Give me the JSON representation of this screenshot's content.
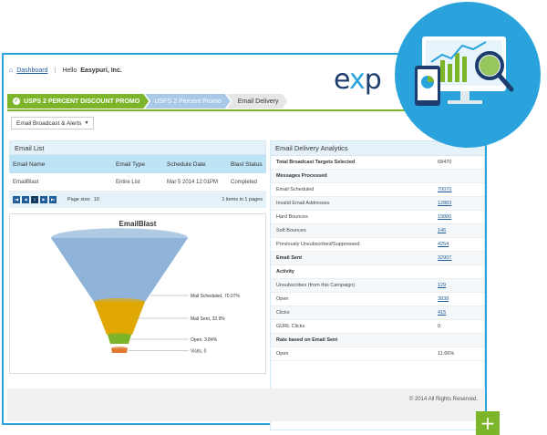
{
  "header": {
    "dashboard_link": "Dashboard",
    "hello_prefix": "Hello",
    "company": "Easypuri, Inc.",
    "logo_left": "e",
    "logo_x": "x",
    "logo_right": "p"
  },
  "breadcrumb": {
    "step1": "USPS 2 PERCENT DISCOUNT PROMO",
    "step2": "USPS 2 Percent Promo",
    "step3": "Email Delivery"
  },
  "menu": {
    "label": "Email Broadcast & Alerts"
  },
  "email_list": {
    "title": "Email List",
    "columns": [
      "Email Name",
      "Email Type",
      "Schedule Date",
      "Blast Status"
    ],
    "rows": [
      [
        "EmailBlast",
        "Entire List",
        "Mar 5 2014 12:01PM",
        "Completed"
      ]
    ],
    "pager": {
      "buttons": [
        "|◀",
        "◀",
        "1",
        "▶",
        "▶|"
      ],
      "page_size_label": "Page size:",
      "page_size": "10",
      "info": "1 items in 1 pages"
    }
  },
  "chart_data": {
    "type": "funnel",
    "title": "EmailBlast",
    "stages": [
      {
        "label": "Mail Scheduled",
        "percent": 70.07,
        "text": "Mail Scheduled, 70.07%"
      },
      {
        "label": "Mail Sent",
        "percent": 32.9,
        "text": "Mail Sent, 32.9%"
      },
      {
        "label": "Open",
        "percent": 3.84,
        "text": "Open, 3.84%"
      },
      {
        "label": "Visits",
        "percent": 0,
        "text": "Visits, 0"
      }
    ],
    "colors": [
      "#8fb3d9",
      "#e0a800",
      "#7cb52a",
      "#e07a30"
    ]
  },
  "analytics": {
    "title": "Email Delivery Analytics",
    "rows": [
      {
        "label": "Total Broadcast Targets Selected",
        "value": "68470",
        "bold": true,
        "link": false
      },
      {
        "label": "Messages Processed",
        "value": "",
        "bold": true,
        "link": false
      },
      {
        "label": "Email Scheduled",
        "value": "70070",
        "bold": false,
        "link": true
      },
      {
        "label": "Invalid Email Addresses",
        "value": "12883",
        "bold": false,
        "link": true
      },
      {
        "label": "Hard Bounces",
        "value": "19880",
        "bold": false,
        "link": true
      },
      {
        "label": "Soft Bounces",
        "value": "146",
        "bold": false,
        "link": true
      },
      {
        "label": "Previously Unsubscribed/Suppressed",
        "value": "4254",
        "bold": false,
        "link": true
      },
      {
        "label": "Email Sent",
        "value": "32907",
        "bold": true,
        "link": true
      },
      {
        "label": "Activity",
        "value": "",
        "bold": true,
        "link": false
      },
      {
        "label": "Unsubscribes (from this Campaign)",
        "value": "129",
        "bold": false,
        "link": true
      },
      {
        "label": "Open",
        "value": "3838",
        "bold": false,
        "link": true
      },
      {
        "label": "Clicks",
        "value": "415",
        "bold": false,
        "link": true
      },
      {
        "label": "GURL Clicks",
        "value": "0",
        "bold": false,
        "link": false
      },
      {
        "label": "Rate based on Email Sent",
        "value": "",
        "bold": true,
        "link": false
      },
      {
        "label": "Open",
        "value": "11.66%",
        "bold": false,
        "link": false
      }
    ]
  },
  "footer": {
    "copyright": "© 2014 All Rights Reserved."
  },
  "plus_label": "+",
  "colors": {
    "accent_blue": "#2aa3dc",
    "accent_green": "#7cb52a",
    "link": "#1f5c9a"
  }
}
